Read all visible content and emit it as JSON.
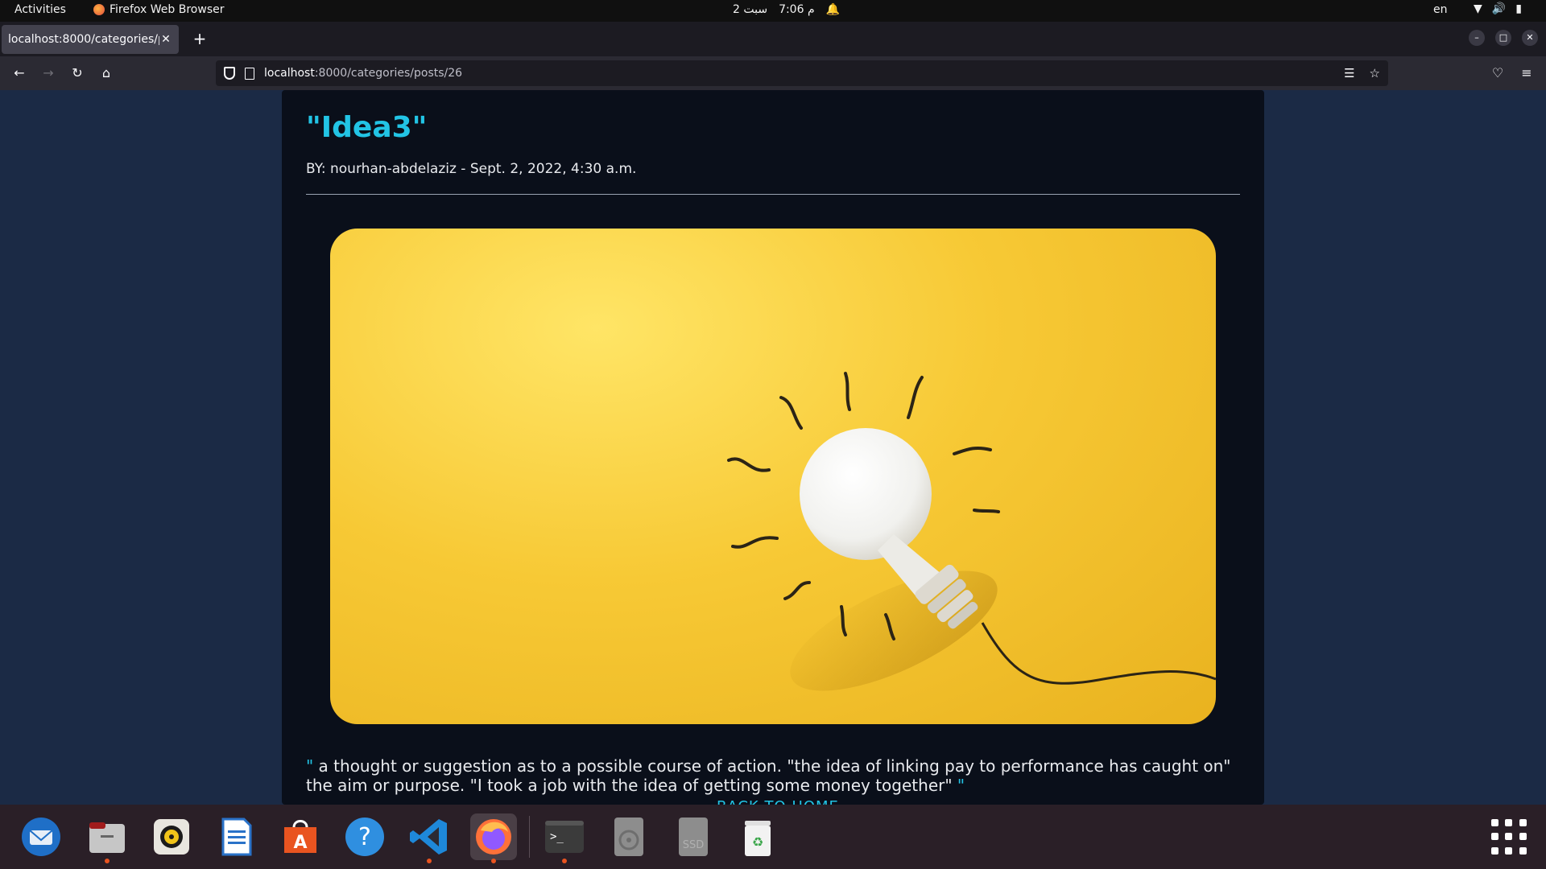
{
  "topbar": {
    "activities": "Activities",
    "app_name": "Firefox Web Browser",
    "clock": "7:06 م",
    "date": "2 سبت",
    "lang": "en"
  },
  "browser": {
    "tab_title": "localhost:8000/categories/p",
    "url_host": "localhost",
    "url_path": ":8000/categories/posts/26"
  },
  "post": {
    "title": "\"Idea3\"",
    "byline": "BY: nourhan-abdelaziz - Sept. 2, 2022, 4:30 a.m.",
    "quote_open": "\"",
    "body": " a thought or suggestion as to a possible course of action. \"the idea of linking pay to performance has caught on\" the aim or purpose. \"I took a job with the idea of getting some money together\" ",
    "quote_close": "\"",
    "back_link": "BACK TO HOME"
  },
  "dock": {
    "apps": [
      "thunderbird-icon",
      "files-icon",
      "rhythmbox-icon",
      "libreoffice-writer-icon",
      "software-center-icon",
      "help-icon",
      "vscode-icon",
      "firefox-icon",
      "terminal-icon",
      "disk-icon",
      "ssd-icon",
      "trash-icon"
    ]
  },
  "colors": {
    "accent": "#22c4e5",
    "page_bg": "#1b2a45",
    "card_bg": "#0a0f1a",
    "image_bg": "#f7c935"
  }
}
